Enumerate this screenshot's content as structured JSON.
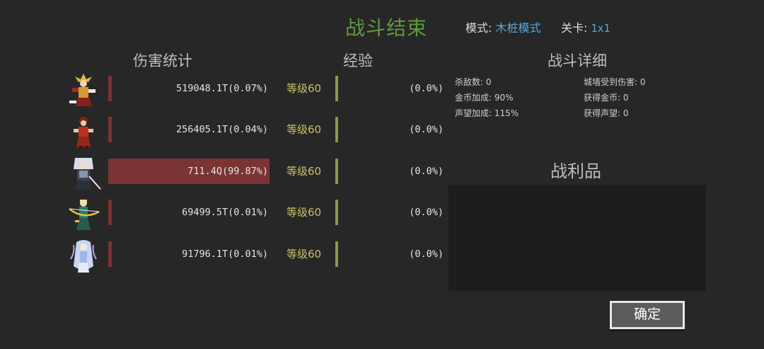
{
  "header": {
    "title": "战斗结束",
    "mode_label": "模式:",
    "mode_value": "木桩模式",
    "stage_label": "关卡:",
    "stage_value": "1x1"
  },
  "sections": {
    "damage": "伤害统计",
    "exp": "经验",
    "details": "战斗详细",
    "loot": "战利品"
  },
  "heroes": [
    {
      "icon": "golden-warrior-sprite-icon",
      "damage": "519048.1T(0.07%)",
      "damage_share": 0.07,
      "level": "等级60",
      "exp": "(0.0%)"
    },
    {
      "icon": "red-fighter-sprite-icon",
      "damage": "256405.1T(0.04%)",
      "damage_share": 0.04,
      "level": "等级60",
      "exp": "(0.0%)"
    },
    {
      "icon": "silver-swordsman-sprite-icon",
      "damage": "711.4Q(99.87%)",
      "damage_share": 99.87,
      "level": "等级60",
      "exp": "(0.0%)"
    },
    {
      "icon": "elf-archer-sprite-icon",
      "damage": "69499.5T(0.01%)",
      "damage_share": 0.01,
      "level": "等级60",
      "exp": "(0.0%)"
    },
    {
      "icon": "ice-maiden-sprite-icon",
      "damage": "91796.1T(0.01%)",
      "damage_share": 0.01,
      "level": "等级60",
      "exp": "(0.0%)"
    }
  ],
  "details": [
    {
      "label": "杀敌数:",
      "value": "0"
    },
    {
      "label": "城墙受到伤害:",
      "value": "0"
    },
    {
      "label": "金币加成:",
      "value": "90%"
    },
    {
      "label": "获得金币:",
      "value": "0"
    },
    {
      "label": "声望加成:",
      "value": "115%"
    },
    {
      "label": "获得声望:",
      "value": "0"
    }
  ],
  "confirm_button": "确定",
  "colors": {
    "background": "#272727",
    "title": "#5c9a3e",
    "damage_bar": "#7a3434",
    "level_text": "#c9c06a",
    "exp_bar": "#8a9a4e",
    "mode_value": "#5aa8de"
  }
}
